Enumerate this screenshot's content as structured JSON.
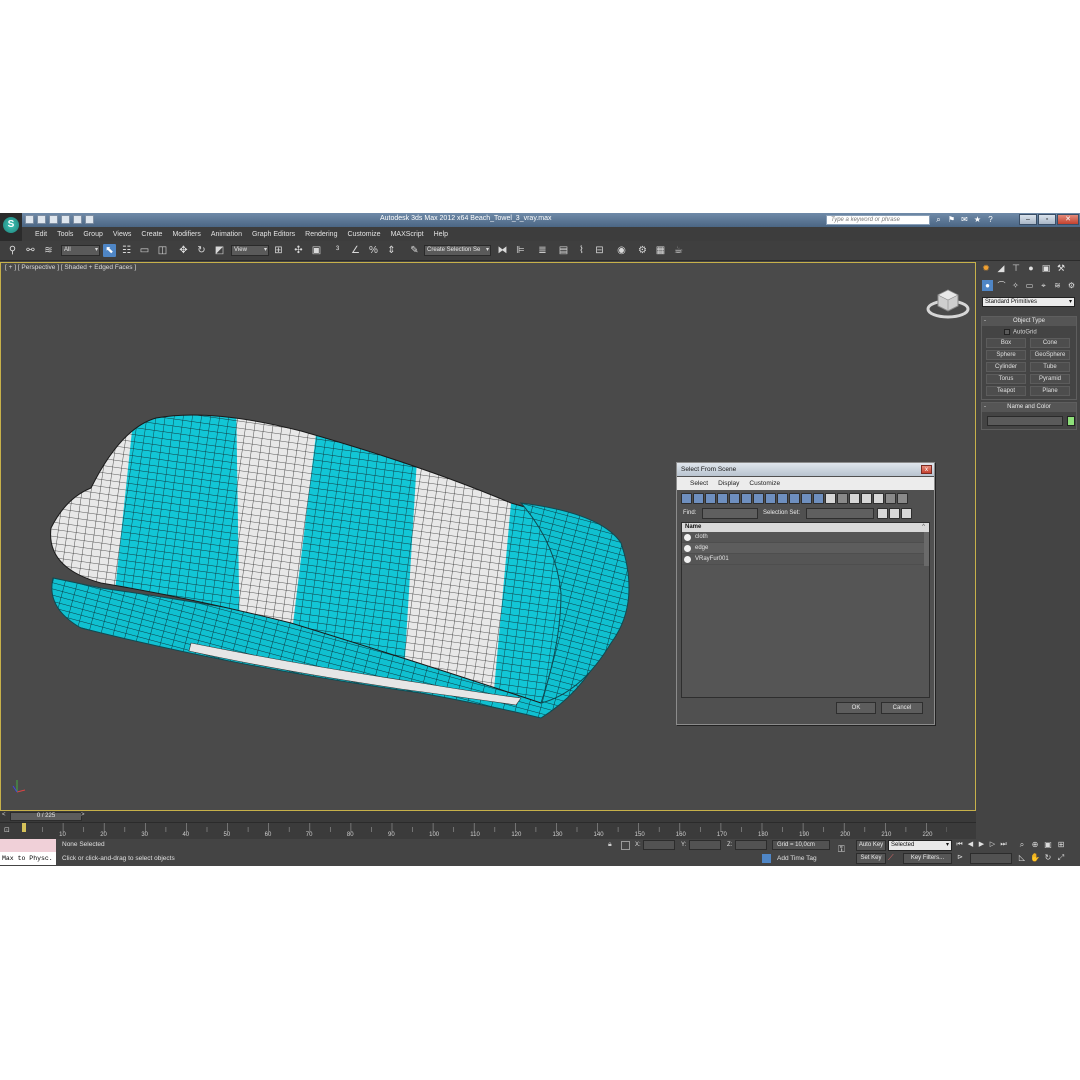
{
  "window": {
    "title": "Autodesk 3ds Max  2012 x64     Beach_Towel_3_vray.max",
    "search_placeholder": "Type a keyword or phrase"
  },
  "menu": [
    "Edit",
    "Tools",
    "Group",
    "Views",
    "Create",
    "Modifiers",
    "Animation",
    "Graph Editors",
    "Rendering",
    "Customize",
    "MAXScript",
    "Help"
  ],
  "toolbar": {
    "filter_value": "All",
    "ref_coord_value": "View",
    "selection_set_placeholder": "Create Selection Se"
  },
  "viewport": {
    "label": "[ + ] [ Perspective ] [ Shaded + Edged Faces ]",
    "object_colors": {
      "cyan": "#12c6d6",
      "white": "#e6e6e6",
      "wire": "#1a1a1a"
    }
  },
  "dialog": {
    "title": "Select From Scene",
    "close_label": "x",
    "menu": [
      "Select",
      "Display",
      "Customize"
    ],
    "find_label": "Find:",
    "selection_set_label": "Selection Set:",
    "column_header": "Name",
    "objects": [
      "cloth",
      "edge",
      "VRayFur001"
    ],
    "ok_label": "OK",
    "cancel_label": "Cancel"
  },
  "command_panel": {
    "primitives_dropdown": "Standard Primitives",
    "object_type_title": "Object Type",
    "autogrid_label": "AutoGrid",
    "object_buttons": [
      "Box",
      "Cone",
      "Sphere",
      "GeoSphere",
      "Cylinder",
      "Tube",
      "Torus",
      "Pyramid",
      "Teapot",
      "Plane"
    ],
    "name_color_title": "Name and Color",
    "swatch_color": "#8ee07a"
  },
  "timeline": {
    "slider_label": "0 / 225",
    "ticks": [
      "10",
      "20",
      "30",
      "40",
      "50",
      "60",
      "70",
      "80",
      "90",
      "100",
      "110",
      "120",
      "130",
      "140",
      "150",
      "160",
      "170",
      "180",
      "190",
      "200",
      "210",
      "220"
    ]
  },
  "status": {
    "listener_text": "Max to Physc.",
    "selection_text": "None Selected",
    "prompt_text": "Click or click-and-drag to select objects",
    "x_label": "X:",
    "y_label": "Y:",
    "z_label": "Z:",
    "grid_text": "Grid = 10,0cm",
    "add_time_tag": "Add Time Tag",
    "auto_key": "Auto Key",
    "set_key": "Set Key",
    "key_mode_value": "Selected",
    "key_filters": "Key Filters..."
  }
}
